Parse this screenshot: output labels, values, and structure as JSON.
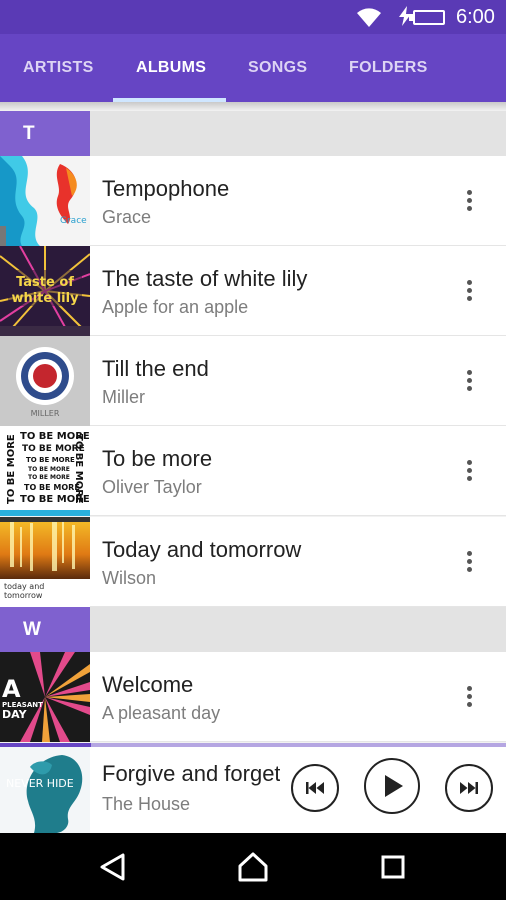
{
  "status_bar": {
    "time": "6:00"
  },
  "tabs": [
    {
      "label": "ARTISTS",
      "active": false
    },
    {
      "label": "ALBUMS",
      "active": true
    },
    {
      "label": "SONGS",
      "active": false
    },
    {
      "label": "FOLDERS",
      "active": false
    }
  ],
  "sections": [
    {
      "letter": "T",
      "albums": [
        {
          "title": "Tempophone",
          "artist": "Grace",
          "art_text": "Grace"
        },
        {
          "title": "The taste of white lily",
          "artist": "Apple for an apple",
          "art_text": "the Taste of white lily"
        },
        {
          "title": "Till the end",
          "artist": "Miller",
          "art_text": "MILLER"
        },
        {
          "title": "To be more",
          "artist": "Oliver Taylor",
          "art_text": "TO BE MORE"
        },
        {
          "title": "Today and tomorrow",
          "artist": "Wilson",
          "art_text": "today and tomorrow"
        }
      ]
    },
    {
      "letter": "W",
      "albums": [
        {
          "title": "Welcome",
          "artist": "A pleasant day",
          "art_text": "A PLEASANT DAY"
        }
      ]
    }
  ],
  "now_playing": {
    "title": "Forgive and forget",
    "artist": "The House",
    "art_text": "NEVER HIDE",
    "progress": 0.18
  },
  "colors": {
    "status_bar": "#5a3ab5",
    "tab_bar": "#6645c4",
    "section_letter": "#7f61cf",
    "tab_indicator": "#cfe6ff"
  }
}
